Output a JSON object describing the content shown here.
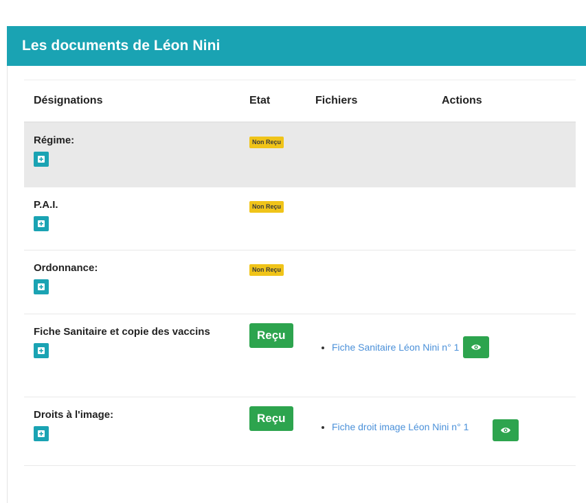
{
  "card": {
    "title": "Les documents de Léon Nini"
  },
  "table": {
    "headers": {
      "designation": "Désignations",
      "etat": "Etat",
      "fichiers": "Fichiers",
      "actions": "Actions"
    },
    "rows": [
      {
        "name": "Régime:",
        "status": "Non Reçu",
        "files": []
      },
      {
        "name": "P.A.I.",
        "status": "Non Reçu",
        "files": []
      },
      {
        "name": "Ordonnance:",
        "status": "Non Reçu",
        "files": []
      },
      {
        "name": "Fiche Sanitaire et copie des vaccins",
        "status": "Reçu",
        "files": [
          "Fiche Sanitaire Léon Nini n° 1"
        ]
      },
      {
        "name": "Droits à l'image:",
        "status": "Reçu",
        "files": [
          "Fiche droit image Léon Nini n° 1"
        ]
      }
    ]
  },
  "icons": {
    "add": "plus-square-icon",
    "view": "eye-icon"
  },
  "colors": {
    "header": "#1aa3b3",
    "add_button": "#1aa3b3",
    "badge_not_received": "#f0c419",
    "badge_received": "#2da44e",
    "link": "#4a90d9",
    "shaded_row": "#e9e9e9"
  }
}
